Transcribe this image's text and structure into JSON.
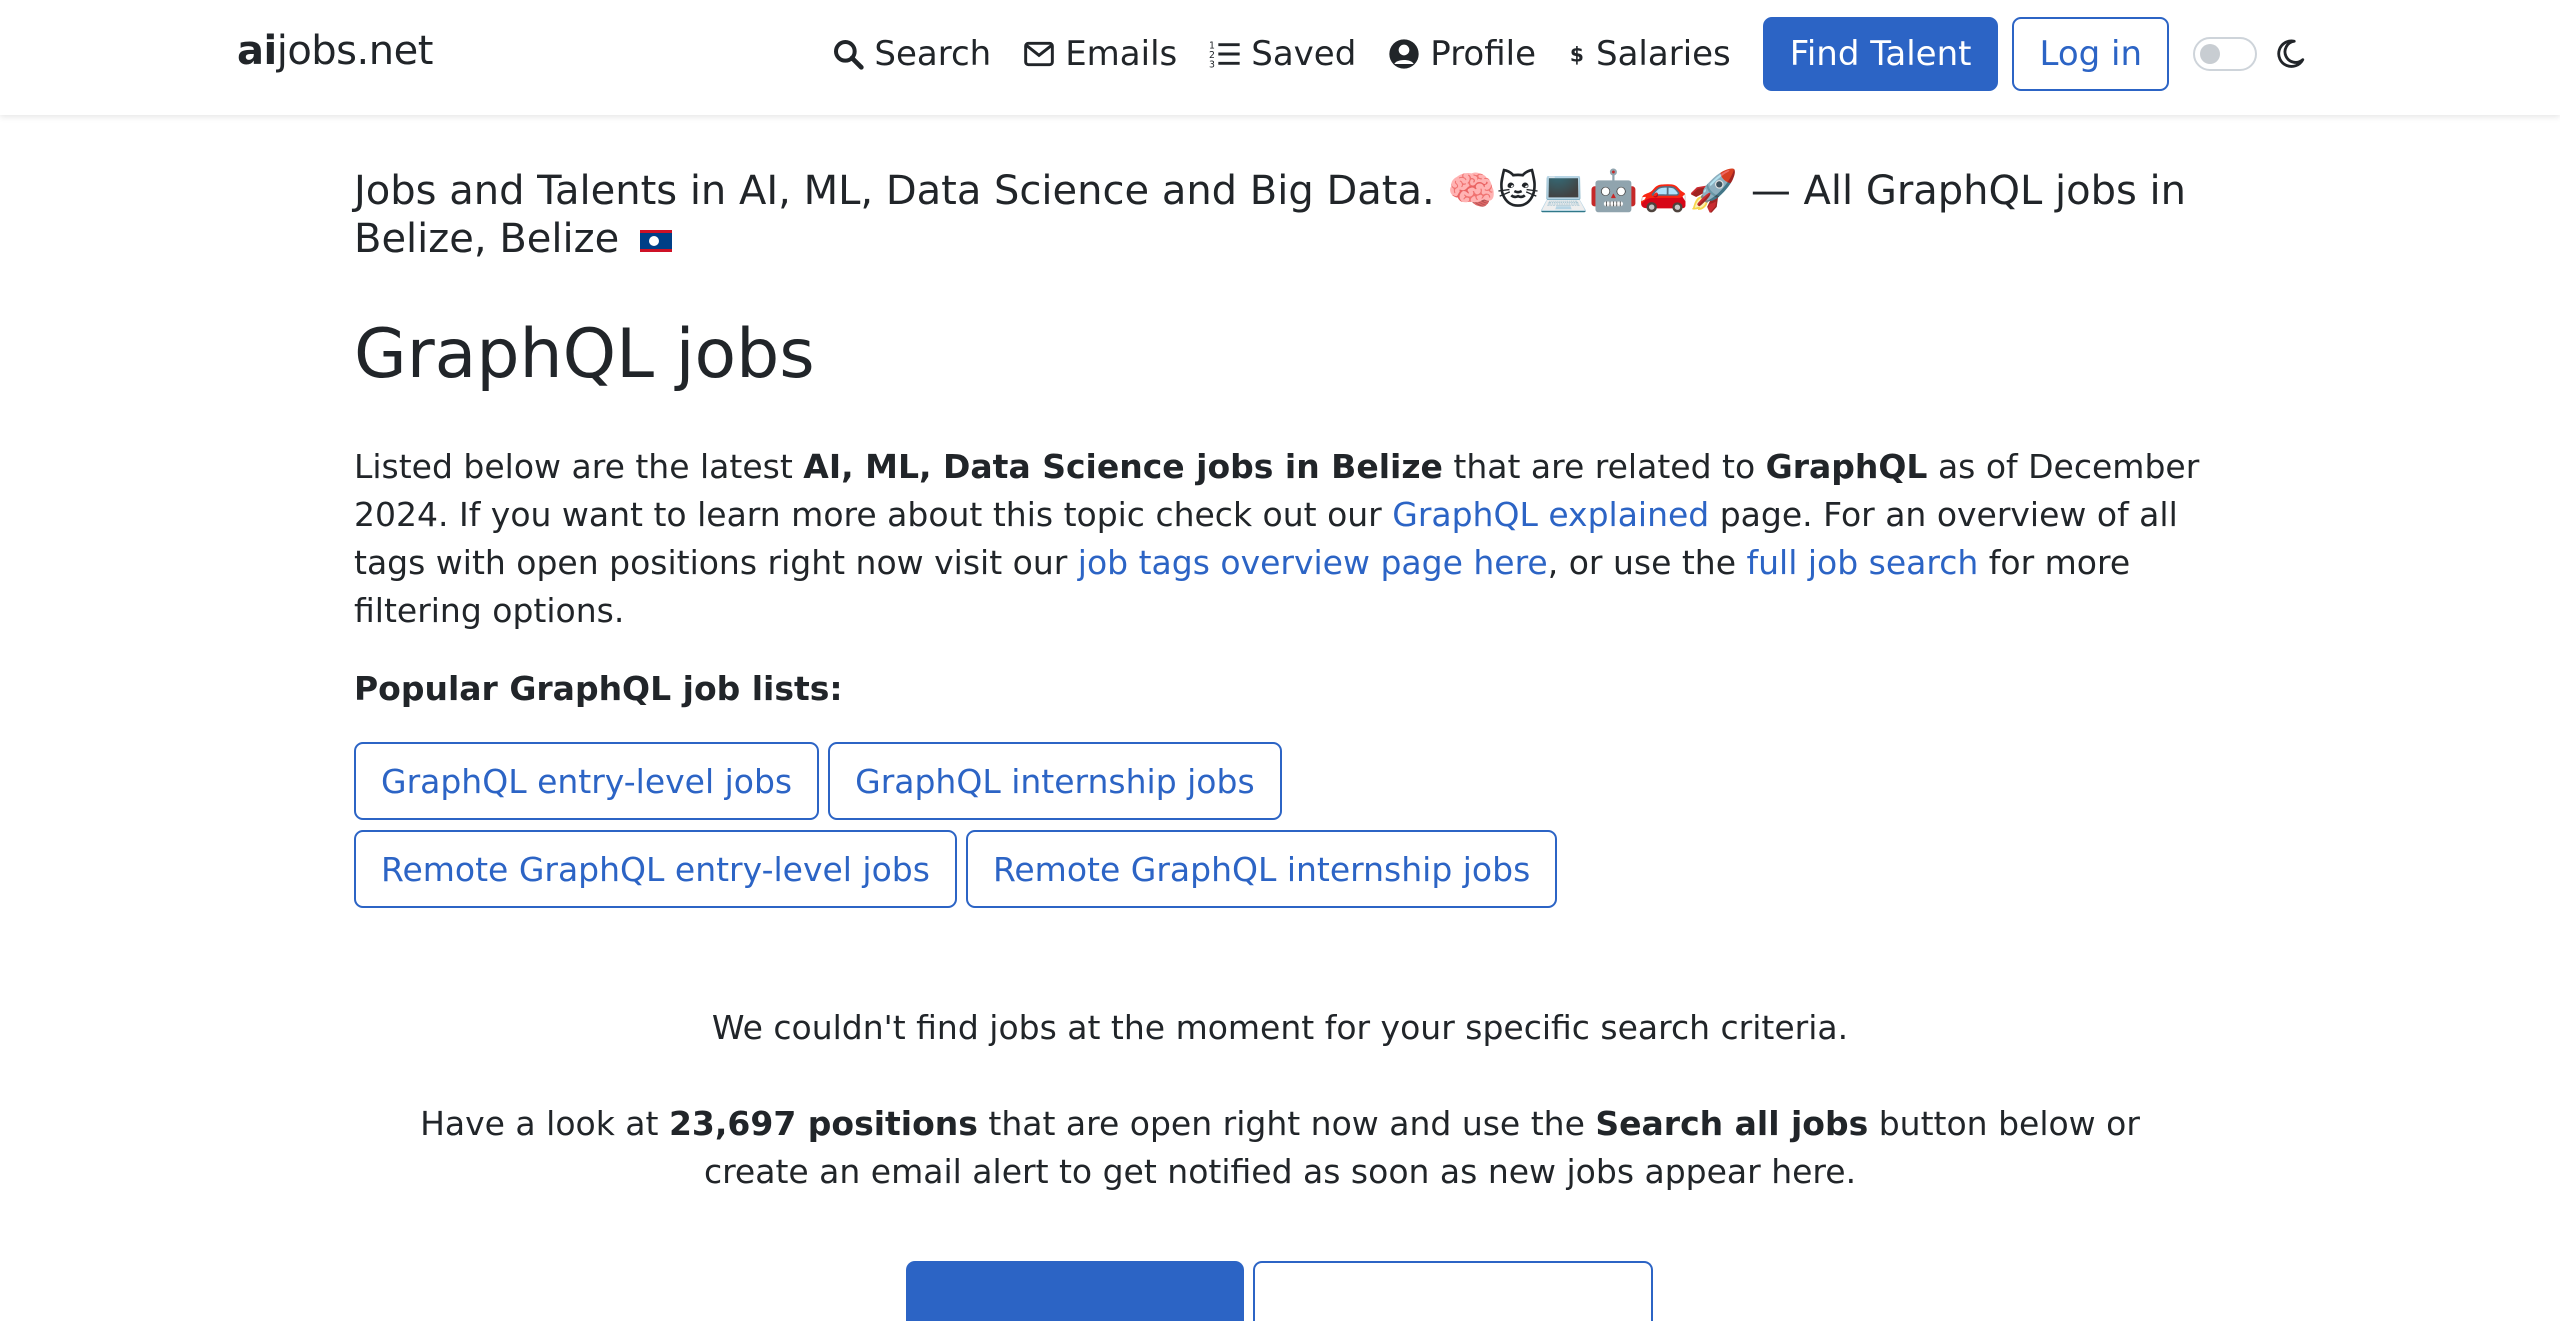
{
  "header": {
    "brand_bold": "ai",
    "brand_rest": "jobs.net",
    "nav": {
      "search": "Search",
      "emails": "Emails",
      "saved": "Saved",
      "profile": "Profile",
      "salaries": "Salaries"
    },
    "find_talent": "Find Talent",
    "log_in": "Log in"
  },
  "lead": {
    "text": "Jobs and Talents in AI, ML, Data Science and Big Data. 🧠🐱💻🤖🚗🚀 — All GraphQL jobs in Belize, Belize"
  },
  "page_title": "GraphQL jobs",
  "intro": {
    "p1": "Listed below are the latest ",
    "b1": "AI, ML, Data Science jobs in Belize",
    "p2": " that are related to ",
    "b2": "GraphQL",
    "p3": " as of December 2024. If you want to learn more about this topic check out our ",
    "link1": "GraphQL explained",
    "p4": " page. For an overview of all tags with open positions right now visit our ",
    "link2": "job tags overview page here",
    "p5": ", or use the ",
    "link3": "full job search",
    "p6": " for more filtering options."
  },
  "popular_heading": "Popular GraphQL job lists:",
  "tags": [
    "GraphQL entry-level jobs",
    "GraphQL internship jobs",
    "Remote GraphQL entry-level jobs",
    "Remote GraphQL internship jobs"
  ],
  "empty_state": {
    "line1": "We couldn't find jobs at the moment for your specific search criteria.",
    "l2a": "Have a look at ",
    "l2b": "23,697 positions",
    "l2c": " that are open right now and use the ",
    "l2d": "Search all jobs",
    "l2e": " button below or create an email alert to get notified as soon as new jobs appear here."
  },
  "colors": {
    "primary": "#2c64c5",
    "text": "#212529"
  }
}
